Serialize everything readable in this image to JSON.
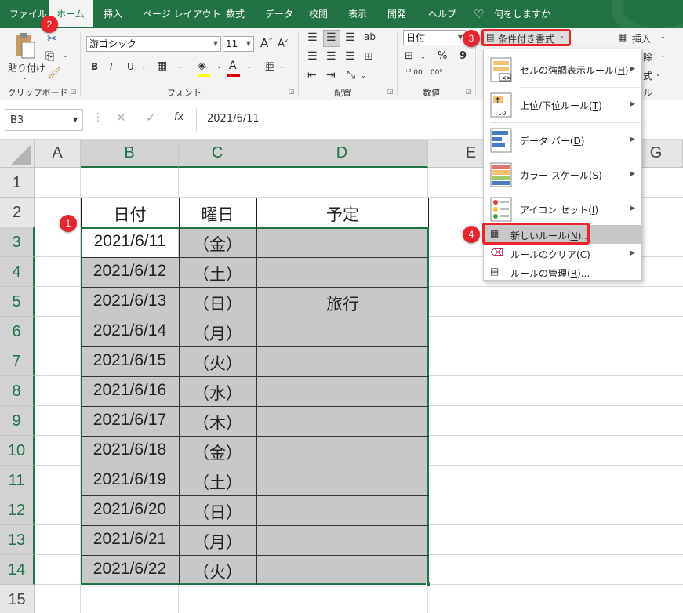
{
  "tabs": [
    {
      "label": "ファイル",
      "active": false
    },
    {
      "label": "ホーム",
      "active": true
    },
    {
      "label": "挿入",
      "active": false
    },
    {
      "label": "ページ レイアウト",
      "active": false
    },
    {
      "label": "数式",
      "active": false
    },
    {
      "label": "データ",
      "active": false
    },
    {
      "label": "校閲",
      "active": false
    },
    {
      "label": "表示",
      "active": false
    },
    {
      "label": "開発",
      "active": false
    },
    {
      "label": "ヘルプ",
      "active": false
    }
  ],
  "tell_me": "何をしますか",
  "ribbon": {
    "clipboard": {
      "paste_label": "貼り付け",
      "group_label": "クリップボード"
    },
    "font": {
      "name": "游ゴシック",
      "size": "11",
      "bold": "B",
      "italic": "I",
      "underline": "U",
      "group_label": "フォント"
    },
    "alignment": {
      "group_label": "配置"
    },
    "number": {
      "format": "日付",
      "percent": "%",
      "comma": "9",
      "group_label": "数値"
    },
    "styles": {
      "conditional_formatting": "条件付き書式"
    },
    "cells": {
      "insert": "挿入",
      "delete": "除",
      "format": "式",
      "group_label_partial": "ル"
    }
  },
  "formula_bar": {
    "name_box": "B3",
    "fx": "fx",
    "value": "2021/6/11"
  },
  "columns": [
    "A",
    "B",
    "C",
    "D",
    "E",
    "G"
  ],
  "rows": [
    "1",
    "2",
    "3",
    "4",
    "5",
    "6",
    "7",
    "8",
    "9",
    "10",
    "11",
    "12",
    "13",
    "14",
    "15"
  ],
  "table": {
    "headers": [
      "日付",
      "曜日",
      "予定"
    ],
    "rows": [
      {
        "date": "2021/6/11",
        "day": "（金）",
        "plan": ""
      },
      {
        "date": "2021/6/12",
        "day": "（土）",
        "plan": ""
      },
      {
        "date": "2021/6/13",
        "day": "（日）",
        "plan": "旅行"
      },
      {
        "date": "2021/6/14",
        "day": "（月）",
        "plan": ""
      },
      {
        "date": "2021/6/15",
        "day": "（火）",
        "plan": ""
      },
      {
        "date": "2021/6/16",
        "day": "（水）",
        "plan": ""
      },
      {
        "date": "2021/6/17",
        "day": "（木）",
        "plan": ""
      },
      {
        "date": "2021/6/18",
        "day": "（金）",
        "plan": ""
      },
      {
        "date": "2021/6/19",
        "day": "（土）",
        "plan": ""
      },
      {
        "date": "2021/6/20",
        "day": "（日）",
        "plan": ""
      },
      {
        "date": "2021/6/21",
        "day": "（月）",
        "plan": ""
      },
      {
        "date": "2021/6/22",
        "day": "（火）",
        "plan": ""
      }
    ]
  },
  "cf_menu": {
    "items": [
      {
        "label": "セルの強調表示ルール",
        "key": "H",
        "icon": "highlight-rules-icon",
        "submenu": true
      },
      {
        "label": "上位/下位ルール",
        "key": "T",
        "icon": "top-bottom-rules-icon",
        "submenu": true
      },
      {
        "label": "データ バー",
        "key": "D",
        "icon": "data-bars-icon",
        "submenu": true
      },
      {
        "label": "カラー スケール",
        "key": "S",
        "icon": "color-scales-icon",
        "submenu": true
      },
      {
        "label": "アイコン セット",
        "key": "I",
        "icon": "icon-sets-icon",
        "submenu": true
      },
      {
        "label": "新しいルール",
        "key": "N",
        "suffix": "...",
        "icon": "new-rule-icon",
        "submenu": false
      },
      {
        "label": "ルールのクリア",
        "key": "C",
        "suffix": "",
        "icon": "clear-rules-icon",
        "submenu": true
      },
      {
        "label": "ルールの管理",
        "key": "R",
        "suffix": "...",
        "icon": "manage-rules-icon",
        "submenu": false
      }
    ]
  },
  "badges": [
    "1",
    "2",
    "3",
    "4"
  ],
  "colors": {
    "excel_green": "#217346",
    "highlight_red": "#e8242c",
    "selection_gray": "#c8c8c8",
    "menu_hover": "#c8c8c8"
  }
}
